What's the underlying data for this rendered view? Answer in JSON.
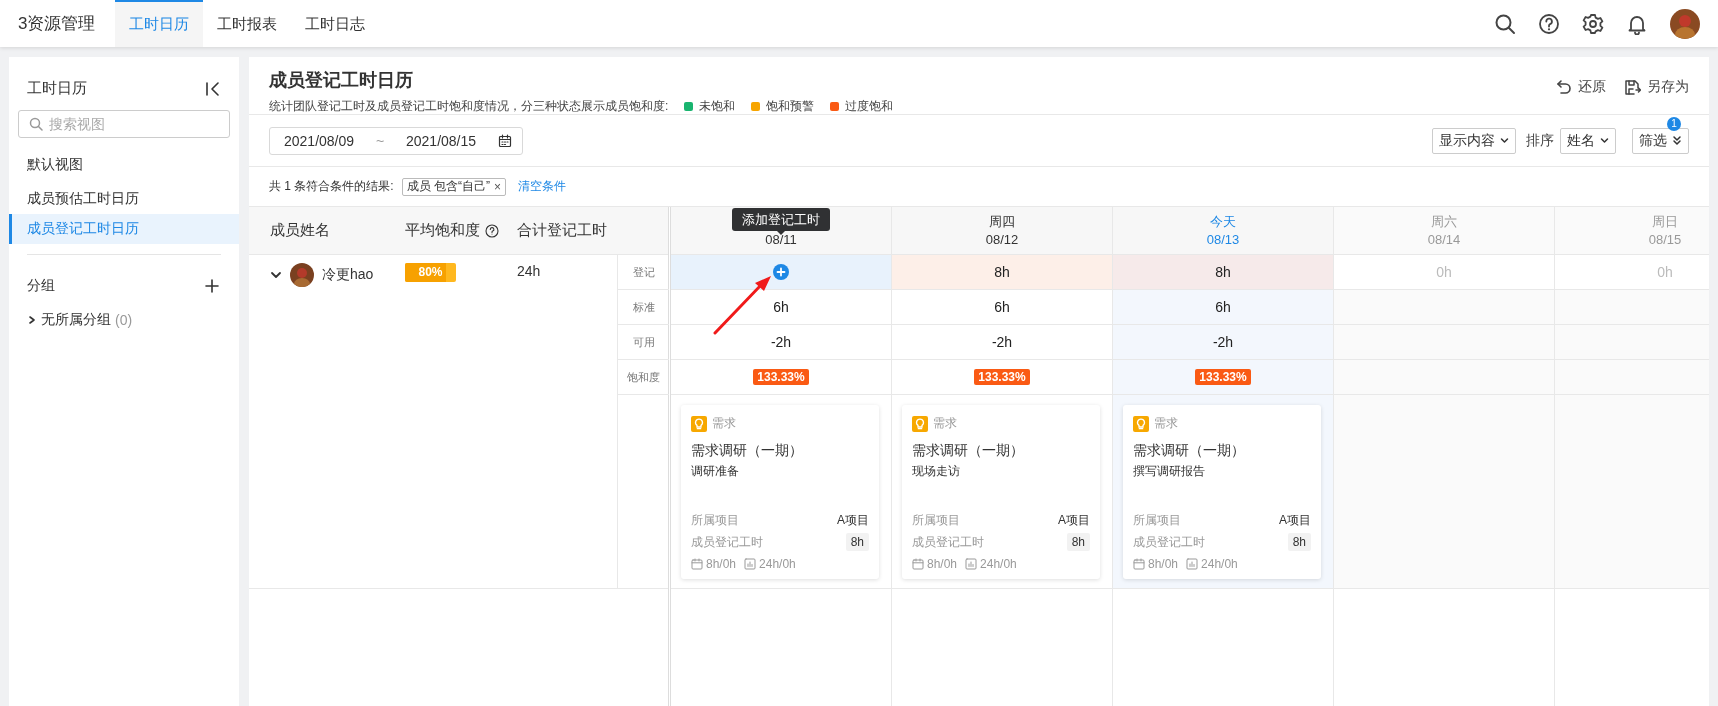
{
  "app": {
    "logo": "3资源管理"
  },
  "nav_tabs": [
    {
      "label": "工时日历",
      "selected": true
    },
    {
      "label": "工时报表",
      "selected": false
    },
    {
      "label": "工时日志",
      "selected": false
    }
  ],
  "sidebar": {
    "title": "工时日历",
    "search": {
      "placeholder": "搜索视图"
    },
    "section": "默认视图",
    "views": [
      {
        "label": "成员预估工时日历",
        "selected": false
      },
      {
        "label": "成员登记工时日历",
        "selected": true
      }
    ],
    "groups_title": "分组",
    "groups": [
      {
        "label": "无所属分组",
        "count": "(0)",
        "expanded": false
      }
    ]
  },
  "page": {
    "title": "成员登记工时日历",
    "description": "统计团队登记工时及成员登记工时饱和度情况，分三种状态展示成员饱和度:",
    "legend": [
      {
        "label": "未饱和",
        "color": "#19b46f"
      },
      {
        "label": "饱和预警",
        "color": "#f7a500"
      },
      {
        "label": "过度饱和",
        "color": "#fa5a14"
      }
    ],
    "actions": [
      {
        "kind": "undo",
        "label": "还原"
      },
      {
        "kind": "save-as",
        "label": "另存为"
      }
    ]
  },
  "toolbar": {
    "date_start": "2021/08/09",
    "separator": "~",
    "date_end": "2021/08/15",
    "display_select": "显示内容",
    "sort_label": "排序",
    "sort_select": "姓名",
    "filter_button": "筛选",
    "filter_badge": "1"
  },
  "filter_summary": {
    "text": "共 1 条符合条件的结果:",
    "tag": "成员 包含“自己”",
    "tag_close": "×",
    "clear": "清空条件"
  },
  "table": {
    "columns": [
      "成员姓名",
      "平均饱和度",
      "合计登记工时"
    ],
    "row_labels": [
      "登记",
      "标准",
      "可用",
      "饱和度"
    ],
    "members": [
      {
        "name": "冷更hao",
        "expanded": true,
        "avg_saturation": "80%",
        "level": 0.8,
        "total": "24h"
      }
    ],
    "days": [
      {
        "date": "08/11",
        "today": false,
        "weekend": false,
        "tooltip": "添加登记工时",
        "pointer_arrow": true,
        "register": {
          "kind": "add"
        },
        "standard": "6h",
        "available": "-2h",
        "saturation": {
          "text": "133.33%",
          "color": "#fa5a14"
        },
        "card": {
          "type": "需求",
          "title": "需求调研（一期）",
          "subtitle": "调研准备",
          "project_label": "所属项目",
          "project": "A项目",
          "hours_label": "成员登记工时",
          "hours": "8h",
          "plan": "8h/0h",
          "sum": "24h/0h"
        }
      },
      {
        "weekday": "周四",
        "date": "08/12",
        "today": false,
        "weekend": false,
        "register": {
          "kind": "hours",
          "value": "8h",
          "color": "#fdefe8"
        },
        "standard": "6h",
        "available": "-2h",
        "saturation": {
          "text": "133.33%",
          "color": "#fa5a14"
        },
        "card": {
          "type": "需求",
          "title": "需求调研（一期）",
          "subtitle": "现场走访",
          "project_label": "所属项目",
          "project": "A项目",
          "hours_label": "成员登记工时",
          "hours": "8h",
          "plan": "8h/0h",
          "sum": "24h/0h"
        }
      },
      {
        "weekday": "今天",
        "date": "08/13",
        "today": true,
        "weekend": false,
        "register": {
          "kind": "hours",
          "value": "8h",
          "color": "#f6eaea"
        },
        "standard": "6h",
        "available": "-2h",
        "saturation": {
          "text": "133.33%",
          "color": "#fa5a14"
        },
        "card": {
          "type": "需求",
          "title": "需求调研（一期）",
          "subtitle": "撰写调研报告",
          "project_label": "所属项目",
          "project": "A项目",
          "hours_label": "成员登记工时",
          "hours": "8h",
          "plan": "8h/0h",
          "sum": "24h/0h"
        }
      },
      {
        "weekday": "周六",
        "date": "08/14",
        "today": false,
        "weekend": true,
        "register": {
          "kind": "hours",
          "value": "0h"
        }
      },
      {
        "weekday": "周日",
        "date": "08/15",
        "today": false,
        "weekend": true,
        "register": {
          "kind": "hours",
          "value": "0h"
        }
      }
    ]
  }
}
